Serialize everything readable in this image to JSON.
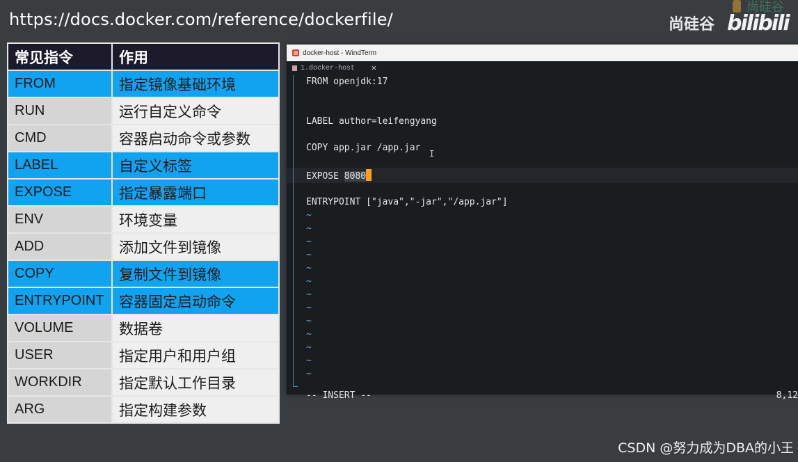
{
  "heading": {
    "url": "https://docs.docker.com/reference/dockerfile/"
  },
  "brand": {
    "name": "尚硅谷",
    "logo": "bilibili-logo"
  },
  "table": {
    "headers": [
      "常见指令",
      "作用"
    ],
    "rows": [
      {
        "cmd": "FROM",
        "desc": "指定镜像基础环境",
        "style": "blue"
      },
      {
        "cmd": "RUN",
        "desc": "运行自定义命令",
        "style": "grey"
      },
      {
        "cmd": "CMD",
        "desc": "容器启动命令或参数",
        "style": "grey"
      },
      {
        "cmd": "LABEL",
        "desc": "自定义标签",
        "style": "blue"
      },
      {
        "cmd": "EXPOSE",
        "desc": "指定暴露端口",
        "style": "blue"
      },
      {
        "cmd": "ENV",
        "desc": "环境变量",
        "style": "grey"
      },
      {
        "cmd": "ADD",
        "desc": "添加文件到镜像",
        "style": "grey"
      },
      {
        "cmd": "COPY",
        "desc": "复制文件到镜像",
        "style": "blue"
      },
      {
        "cmd": "ENTRYPOINT",
        "desc": "容器固定启动命令",
        "style": "blue"
      },
      {
        "cmd": "VOLUME",
        "desc": "数据卷",
        "style": "grey"
      },
      {
        "cmd": "USER",
        "desc": "指定用户和用户组",
        "style": "grey"
      },
      {
        "cmd": "WORKDIR",
        "desc": "指定默认工作目录",
        "style": "grey"
      },
      {
        "cmd": "ARG",
        "desc": "指定构建参数",
        "style": "grey"
      }
    ],
    "colors": {
      "blue": "#11a3f0",
      "header": "#1d1a2b",
      "grey": "#e4e4e4"
    }
  },
  "terminal": {
    "window_title": "docker-host - WindTerm",
    "tab_label": "1.docker-host",
    "tab_close": "×",
    "lines": [
      "FROM openjdk:17",
      "",
      "",
      "LABEL author=leifengyang",
      "",
      "COPY app.jar /app.jar",
      "",
      "EXPOSE ",
      "",
      "ENTRYPOINT [\"java\",\"-jar\",\"/app.jar\"]"
    ],
    "expose_port": "8080",
    "tilde": "~",
    "tilde_count": 13,
    "mode": "-- INSERT --",
    "position": "8,12",
    "cursor_color": "#ff9d1a"
  },
  "watermark": {
    "text": "CSDN @努力成为DBA的小王"
  }
}
